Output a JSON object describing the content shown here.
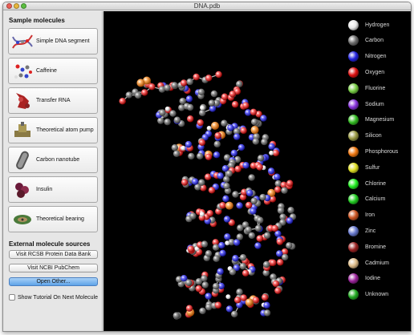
{
  "window": {
    "title": "DNA.pdb"
  },
  "sidebar": {
    "sample_heading": "Sample molecules",
    "molecules": [
      {
        "label": "Simple DNA segment",
        "icon": "dna-icon"
      },
      {
        "label": "Caffeine",
        "icon": "caffeine-icon"
      },
      {
        "label": "Transfer RNA",
        "icon": "trna-icon"
      },
      {
        "label": "Theoretical atom pump",
        "icon": "atom-pump-icon"
      },
      {
        "label": "Carbon nanotube",
        "icon": "nanotube-icon"
      },
      {
        "label": "Insulin",
        "icon": "insulin-icon"
      },
      {
        "label": "Theoretical bearing",
        "icon": "bearing-icon"
      }
    ],
    "external_heading": "External molecule sources",
    "external_buttons": [
      {
        "label": "Visit RCSB Protein Data Bank"
      },
      {
        "label": "Visit NCBI PubChem"
      },
      {
        "label": "Open Other..."
      }
    ],
    "tutorial_checkbox": {
      "label": "Show Tutorial On Next Molecule",
      "checked": false
    }
  },
  "legend": [
    {
      "label": "Hydrogen",
      "color": "#e8e8e8"
    },
    {
      "label": "Carbon",
      "color": "#6b6b6b"
    },
    {
      "label": "Nitrogen",
      "color": "#2222dd"
    },
    {
      "label": "Oxygen",
      "color": "#dd1111"
    },
    {
      "label": "Fluorine",
      "color": "#77cc44"
    },
    {
      "label": "Sodium",
      "color": "#8833dd"
    },
    {
      "label": "Magnesium",
      "color": "#33bb22"
    },
    {
      "label": "Silicon",
      "color": "#999944"
    },
    {
      "label": "Phosphorous",
      "color": "#ee7711"
    },
    {
      "label": "Sulfur",
      "color": "#dddd22"
    },
    {
      "label": "Chlorine",
      "color": "#22ee22"
    },
    {
      "label": "Calcium",
      "color": "#22cc22"
    },
    {
      "label": "Iron",
      "color": "#cc5522"
    },
    {
      "label": "Zinc",
      "color": "#6677cc"
    },
    {
      "label": "Bromine",
      "color": "#992222"
    },
    {
      "label": "Cadmium",
      "color": "#ddbb88"
    },
    {
      "label": "Iodine",
      "color": "#992299"
    },
    {
      "label": "Unknown",
      "color": "#22aa22"
    }
  ]
}
